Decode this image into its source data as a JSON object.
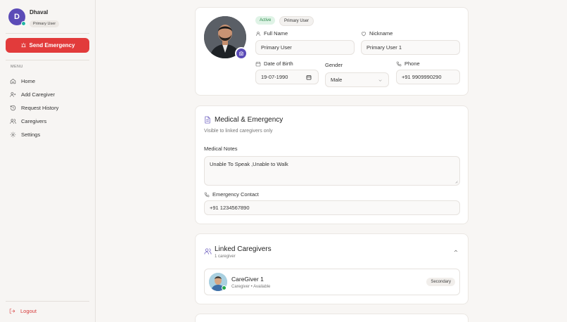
{
  "user": {
    "initial": "D",
    "name": "Dhaval",
    "role_badge": "Primary User"
  },
  "sidebar": {
    "emergency_label": "Send Emergency",
    "menu_label": "MENU",
    "items": [
      {
        "label": "Home",
        "icon": "home-icon"
      },
      {
        "label": "Add Caregiver",
        "icon": "user-plus-icon"
      },
      {
        "label": "Request History",
        "icon": "history-icon"
      },
      {
        "label": "Caregivers",
        "icon": "users-icon"
      },
      {
        "label": "Settings",
        "icon": "gear-icon"
      }
    ],
    "logout_label": "Logout"
  },
  "profile": {
    "status_badge": "Active",
    "role_badge": "Primary User",
    "full_name_label": "Full Name",
    "full_name_value": "Primary User",
    "nickname_label": "Nickname",
    "nickname_value": "Primary User 1",
    "dob_label": "Date of Birth",
    "dob_value": "19-07-1990",
    "gender_label": "Gender",
    "gender_value": "Male",
    "phone_label": "Phone",
    "phone_value": "+91 9909990290"
  },
  "medical": {
    "title": "Medical & Emergency",
    "subtitle": "Visible to linked caregivers only",
    "notes_label": "Medical Notes",
    "notes_value": "Unable To Speak ,Unable to Walk",
    "contact_label": "Emergency Contact",
    "contact_value": "+91 1234567890"
  },
  "caregivers": {
    "title": "Linked Caregivers",
    "count": "1 caregiver",
    "items": [
      {
        "name": "CareGiver 1",
        "meta": "Caregiver • Available",
        "role": "Secondary"
      }
    ]
  },
  "colors": {
    "accent": "#5b4bb7",
    "danger": "#e23b3b",
    "online": "#24a84a"
  }
}
